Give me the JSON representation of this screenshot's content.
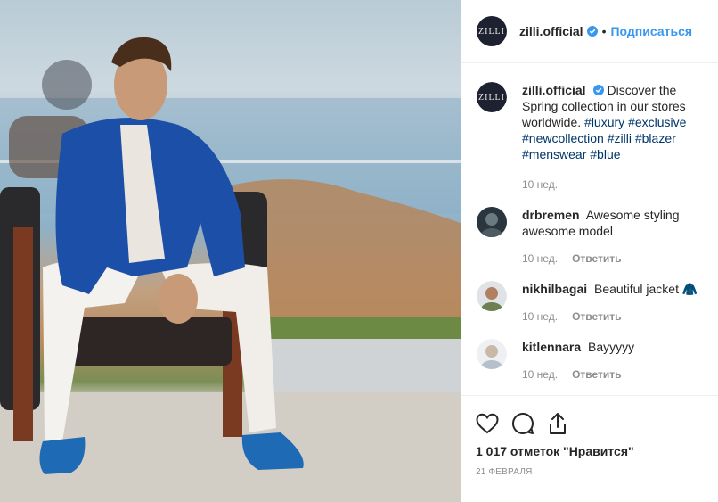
{
  "account": {
    "username": "zilli.official",
    "avatar_text": "ZILLI",
    "dot": "•",
    "follow_label": "Подписаться"
  },
  "caption": {
    "username": "zilli.official",
    "text": "Discover the Spring collection in our stores worldwide.",
    "hashtags": [
      "#luxury",
      "#exclusive",
      "#newcollection",
      "#zilli",
      "#blazer",
      "#menswear",
      "#blue"
    ],
    "time": "10 нед."
  },
  "comments": [
    {
      "username": "drbremen",
      "text": "Awesome styling awesome model",
      "time": "10 нед.",
      "reply_label": "Ответить",
      "avatar_color": "#3a4550"
    },
    {
      "username": "nikhilbagai",
      "text": "Beautiful jacket",
      "emoji": "🧥",
      "time": "10 нед.",
      "reply_label": "Ответить",
      "avatar_color": "#8a9a6a"
    },
    {
      "username": "kitlennara",
      "text": "Bayyyyy",
      "time": "10 нед.",
      "reply_label": "Ответить",
      "avatar_color": "#c8ccd4"
    }
  ],
  "actions": {
    "likes": "1 017 отметок \"Нравится\"",
    "date": "21 ФЕВРАЛЯ"
  },
  "colors": {
    "link": "#3897f0",
    "hashtag": "#003569",
    "verified": "#3897f0",
    "blazer": "#1c4fa8"
  },
  "icons": [
    "verified-badge-icon",
    "heart-icon",
    "comment-icon",
    "share-icon"
  ]
}
